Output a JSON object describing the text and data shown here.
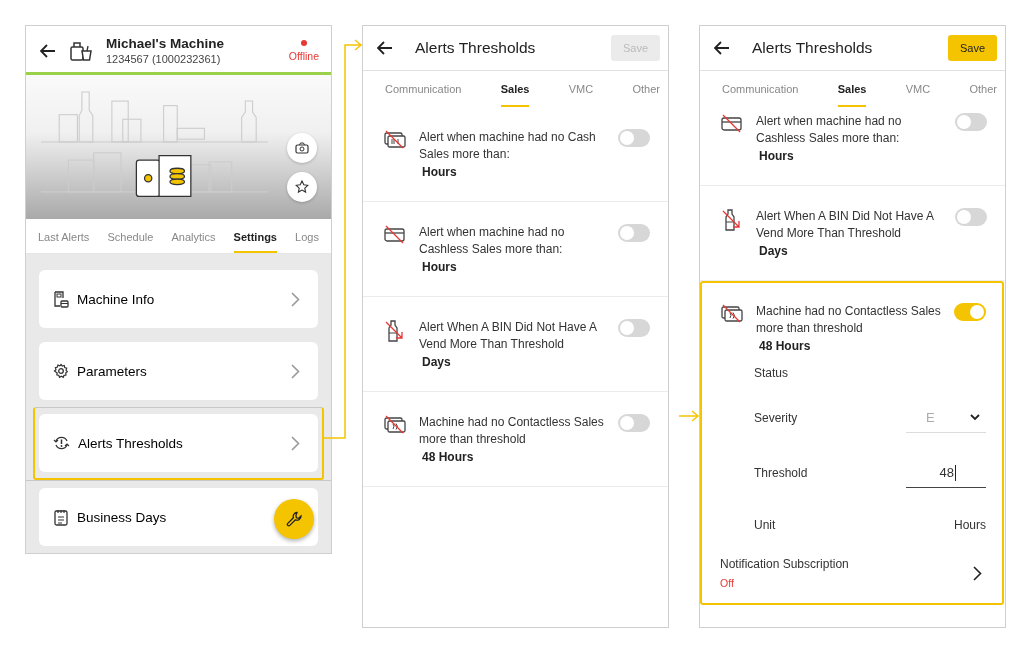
{
  "machine_screen": {
    "title": "Michael's Machine",
    "subtitle": "1234567 (1000232361)",
    "status": "Offline",
    "online": false,
    "tabs": [
      {
        "label": "Last Alerts",
        "selected": false
      },
      {
        "label": "Schedule",
        "selected": false
      },
      {
        "label": "Analytics",
        "selected": false
      },
      {
        "label": "Settings",
        "selected": true
      },
      {
        "label": "Logs",
        "selected": false
      }
    ],
    "menu": [
      {
        "label": "Machine Info",
        "kind": "info",
        "highlighted": false
      },
      {
        "label": "Parameters",
        "kind": "gear",
        "highlighted": false
      },
      {
        "label": "Alerts Thresholds",
        "kind": "alert",
        "highlighted": true
      },
      {
        "label": "Business Days",
        "kind": "notes",
        "highlighted": false
      }
    ]
  },
  "thresholds_list": {
    "title": "Alerts Thresholds",
    "save": {
      "label": "Save",
      "enabled": false
    },
    "tabs": [
      {
        "label": "Communication",
        "selected": false
      },
      {
        "label": "Sales",
        "selected": true
      },
      {
        "label": "VMC",
        "selected": false
      },
      {
        "label": "Other",
        "selected": false
      }
    ],
    "alerts": [
      {
        "kind": "cash",
        "text": "Alert when machine had no Cash Sales more than:",
        "value": "Hours",
        "on": false,
        "expanded": false
      },
      {
        "kind": "cashless",
        "text": "Alert when machine had no Cashless Sales more than:",
        "value": "Hours",
        "on": false,
        "expanded": false
      },
      {
        "kind": "bin",
        "text": "Alert When A BIN Did Not Have A Vend More Than Threshold",
        "value": "Days",
        "on": false,
        "expanded": false
      },
      {
        "kind": "contactless",
        "text": "Machine had no Contactless Sales more than threshold",
        "value": "48 Hours",
        "on": false,
        "expanded": false
      }
    ]
  },
  "thresholds_detail": {
    "title": "Alerts Thresholds",
    "save": {
      "label": "Save",
      "enabled": true
    },
    "tabs": [
      {
        "label": "Communication",
        "selected": false
      },
      {
        "label": "Sales",
        "selected": true
      },
      {
        "label": "VMC",
        "selected": false
      },
      {
        "label": "Other",
        "selected": false
      }
    ],
    "alerts": [
      {
        "kind": "cashless",
        "text": "Alert when machine had no Cashless Sales more than:",
        "value": "Hours",
        "on": false,
        "expanded": false
      },
      {
        "kind": "bin",
        "text": "Alert When A BIN Did Not Have A Vend More Than Threshold",
        "value": "Days",
        "on": false,
        "expanded": false
      },
      {
        "kind": "contactless",
        "text": "Machine had no Contactless Sales more than threshold",
        "value": "48 Hours",
        "on": true,
        "expanded": true,
        "details": {
          "status_label": "Status",
          "severity_label": "Severity",
          "severity": "E",
          "threshold_label": "Threshold",
          "threshold": "48",
          "unit_label": "Unit",
          "unit": "Hours",
          "notification_label": "Notification Subscription",
          "notification": "Off"
        }
      }
    ]
  }
}
